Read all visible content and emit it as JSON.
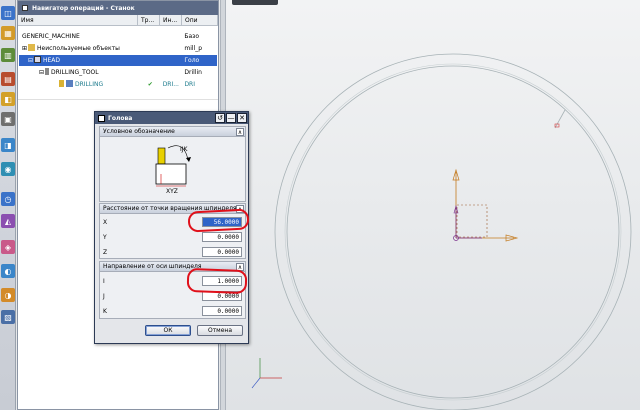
{
  "navigator": {
    "title": "Навигатор операций - Станок",
    "columns": [
      "Имя",
      "Тр...",
      "Ин...",
      "Опи"
    ],
    "rows": [
      {
        "name": "GENERIC_MACHINE",
        "path": "",
        "tool": "",
        "desc": "Базо"
      },
      {
        "name": "Неиспользуемые объекты",
        "path": "",
        "tool": "",
        "desc": "mill_p"
      },
      {
        "name": "HEAD",
        "path": "",
        "tool": "",
        "desc": "Голо"
      },
      {
        "name": "DRILLING_TOOL",
        "path": "",
        "tool": "",
        "desc": "Drillin"
      },
      {
        "name": "DRILLING",
        "path": "✔",
        "tool": "DRI...",
        "desc": "DRI"
      }
    ]
  },
  "dialog": {
    "title": "Голова",
    "section_symbol": "Условное обозначение",
    "section_distance": "Расстояние от точки вращения шпинделя",
    "section_direction": "Направление от оси шпинделя",
    "fields_distance": [
      {
        "label": "X",
        "value": "56.0000"
      },
      {
        "label": "Y",
        "value": "0.0000"
      },
      {
        "label": "Z",
        "value": "0.0000"
      }
    ],
    "fields_direction": [
      {
        "label": "I",
        "value": "1.0000"
      },
      {
        "label": "J",
        "value": "0.0000"
      },
      {
        "label": "K",
        "value": "0.0000"
      }
    ],
    "diagram_labels": {
      "ijk": "IJK",
      "xyz": "XYZ"
    },
    "ok_label": "ОК",
    "cancel_label": "Отмена"
  },
  "colors": {
    "selection": "#2f64c8",
    "title_bar": "#5b6a86",
    "annotation": "#e0101a",
    "axis_orange": "#c47a1e",
    "axis_purple": "#7a2f8c"
  }
}
